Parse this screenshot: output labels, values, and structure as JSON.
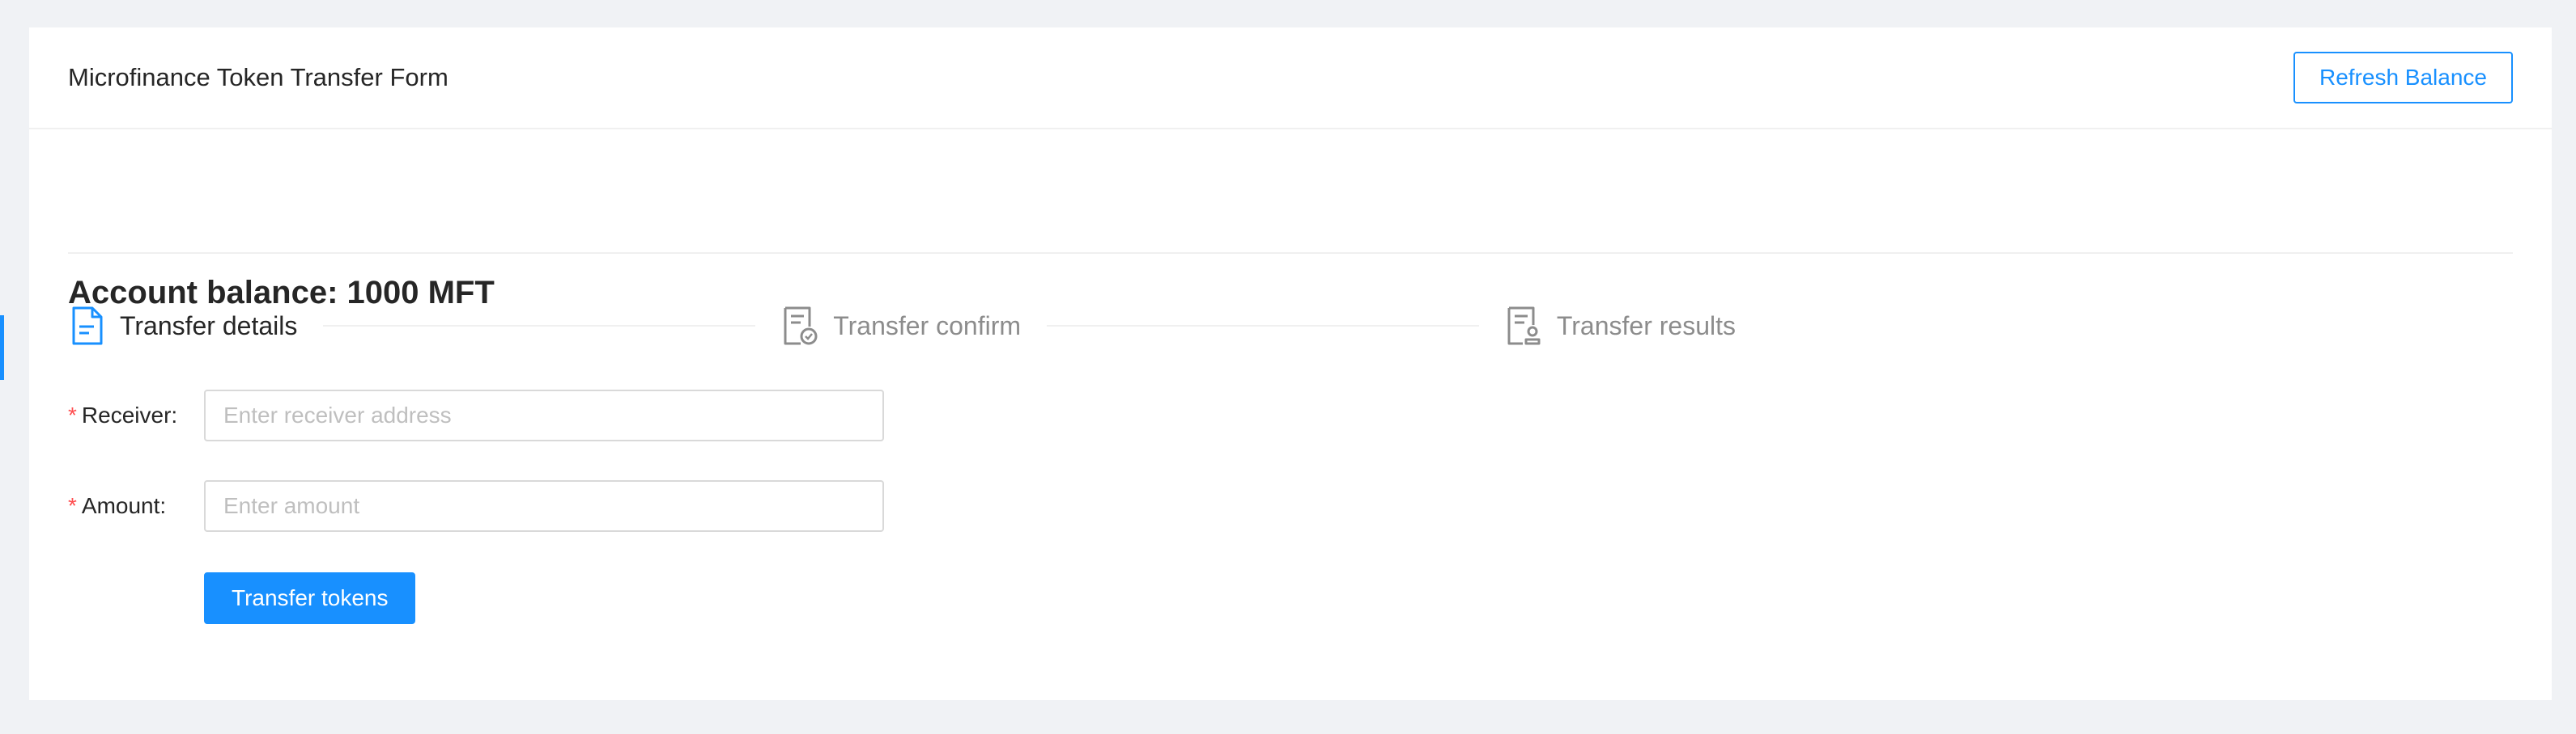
{
  "header": {
    "title": "Microfinance Token Transfer Form",
    "refresh_label": "Refresh Balance"
  },
  "balance": {
    "text": "Account balance: 1000 MFT"
  },
  "steps": [
    {
      "label": "Transfer details",
      "icon": "file-text-icon",
      "status": "active"
    },
    {
      "label": "Transfer confirm",
      "icon": "file-check-icon",
      "status": "inactive"
    },
    {
      "label": "Transfer results",
      "icon": "file-user-icon",
      "status": "inactive"
    }
  ],
  "form": {
    "receiver": {
      "label": "Receiver",
      "colon": ":",
      "required_mark": "*",
      "value": "",
      "placeholder": "Enter receiver address"
    },
    "amount": {
      "label": "Amount",
      "colon": ":",
      "required_mark": "*",
      "value": "",
      "placeholder": "Enter amount"
    },
    "submit_label": "Transfer tokens"
  },
  "colors": {
    "accent": "#1890ff",
    "required": "#ff4d4f",
    "background": "#f0f2f5"
  }
}
